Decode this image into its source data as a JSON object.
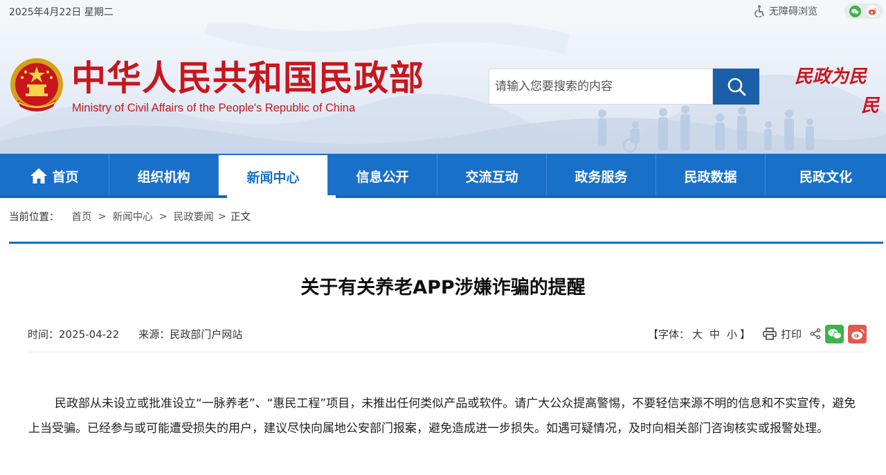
{
  "topbar": {
    "date": "2025年4月22日 星期二",
    "accessibility_label": "无障碍浏览"
  },
  "header": {
    "title": "中华人民共和国民政部",
    "subtitle": "Ministry of Civil Affairs of the People's Republic of China",
    "search_placeholder": "请输入您要搜索的内容",
    "slogan_line1": "民政为民",
    "slogan_line2": "民"
  },
  "nav": {
    "items": [
      {
        "label": "首页",
        "icon": "home-icon"
      },
      {
        "label": "组织机构"
      },
      {
        "label": "新闻中心",
        "active": true
      },
      {
        "label": "信息公开"
      },
      {
        "label": "交流互动"
      },
      {
        "label": "政务服务"
      },
      {
        "label": "民政数据"
      },
      {
        "label": "民政文化"
      }
    ]
  },
  "breadcrumb": {
    "lead": "当前位置：",
    "items": [
      "首页",
      "新闻中心",
      "民政要闻",
      "正文"
    ],
    "separator": ">"
  },
  "article": {
    "title": "关于有关养老APP涉嫌诈骗的提醒",
    "time_label": "时间：2025-04-22",
    "source_label": "来源：民政部门户网站",
    "font_size_label_open": "【字体：",
    "font_sizes": [
      "大",
      "中",
      "小"
    ],
    "font_size_label_close": "】",
    "print_label": "打印",
    "body": "民政部从未设立或批准设立“一脉养老”、“惠民工程”项目，未推出任何类似产品或软件。请广大公众提高警惕，不要轻信来源不明的信息和不实宣传，避免上当受骗。已经参与或可能遭受损失的用户，建议尽快向属地公安部门报案，避免造成进一步损失。如遇可疑情况，及时向相关部门咨询核实或报警处理。"
  },
  "colors": {
    "brand_red": "#c8161d",
    "nav_blue": "#1970c8",
    "search_blue": "#1a5fa8",
    "wechat_green": "#3bb44a",
    "weibo_red": "#e6574e"
  }
}
